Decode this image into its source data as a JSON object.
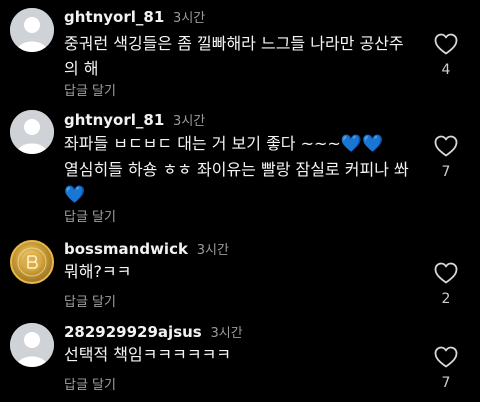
{
  "comments": [
    {
      "username": "ghtnyorl_81",
      "time": "3시간",
      "lines": [
        "중궈런 색깅들은 좀 낄빠해라 느그들 나라만 공산주",
        "의 해"
      ],
      "reply_label": "답글 달기",
      "likes": "4",
      "avatar": "default-avatar"
    },
    {
      "username": "ghtnyorl_81",
      "time": "3시간",
      "lines": [
        "좌파들 ㅂㄷㅂㄷ 대는 거 보기 좋다 ~~~",
        "열심히들 하숑 ㅎㅎ 좌이유는 빨랑 잠실로 커피나 쏴"
      ],
      "emoji_line1": "💙💙",
      "emoji_line3": "💙",
      "reply_label": "답글 달기",
      "likes": "7",
      "avatar": "default-avatar"
    },
    {
      "username": "bossmandwick",
      "time": "3시간",
      "lines": [
        "뭐해?ㅋㅋ"
      ],
      "reply_label": "답글 달기",
      "likes": "2",
      "avatar": "gold-coin-avatar"
    },
    {
      "username": "282929929ajsus",
      "time": "3시간",
      "lines": [
        "선택적 책임ㅋㅋㅋㅋㅋㅋ"
      ],
      "reply_label": "답글 달기",
      "likes": "7",
      "avatar": "default-avatar"
    }
  ],
  "colors": {
    "background": "#000000",
    "blue_heart": "#3b82f6",
    "gold_ring": "#e9b949"
  },
  "icons": {
    "like": "heart-outline-icon"
  }
}
